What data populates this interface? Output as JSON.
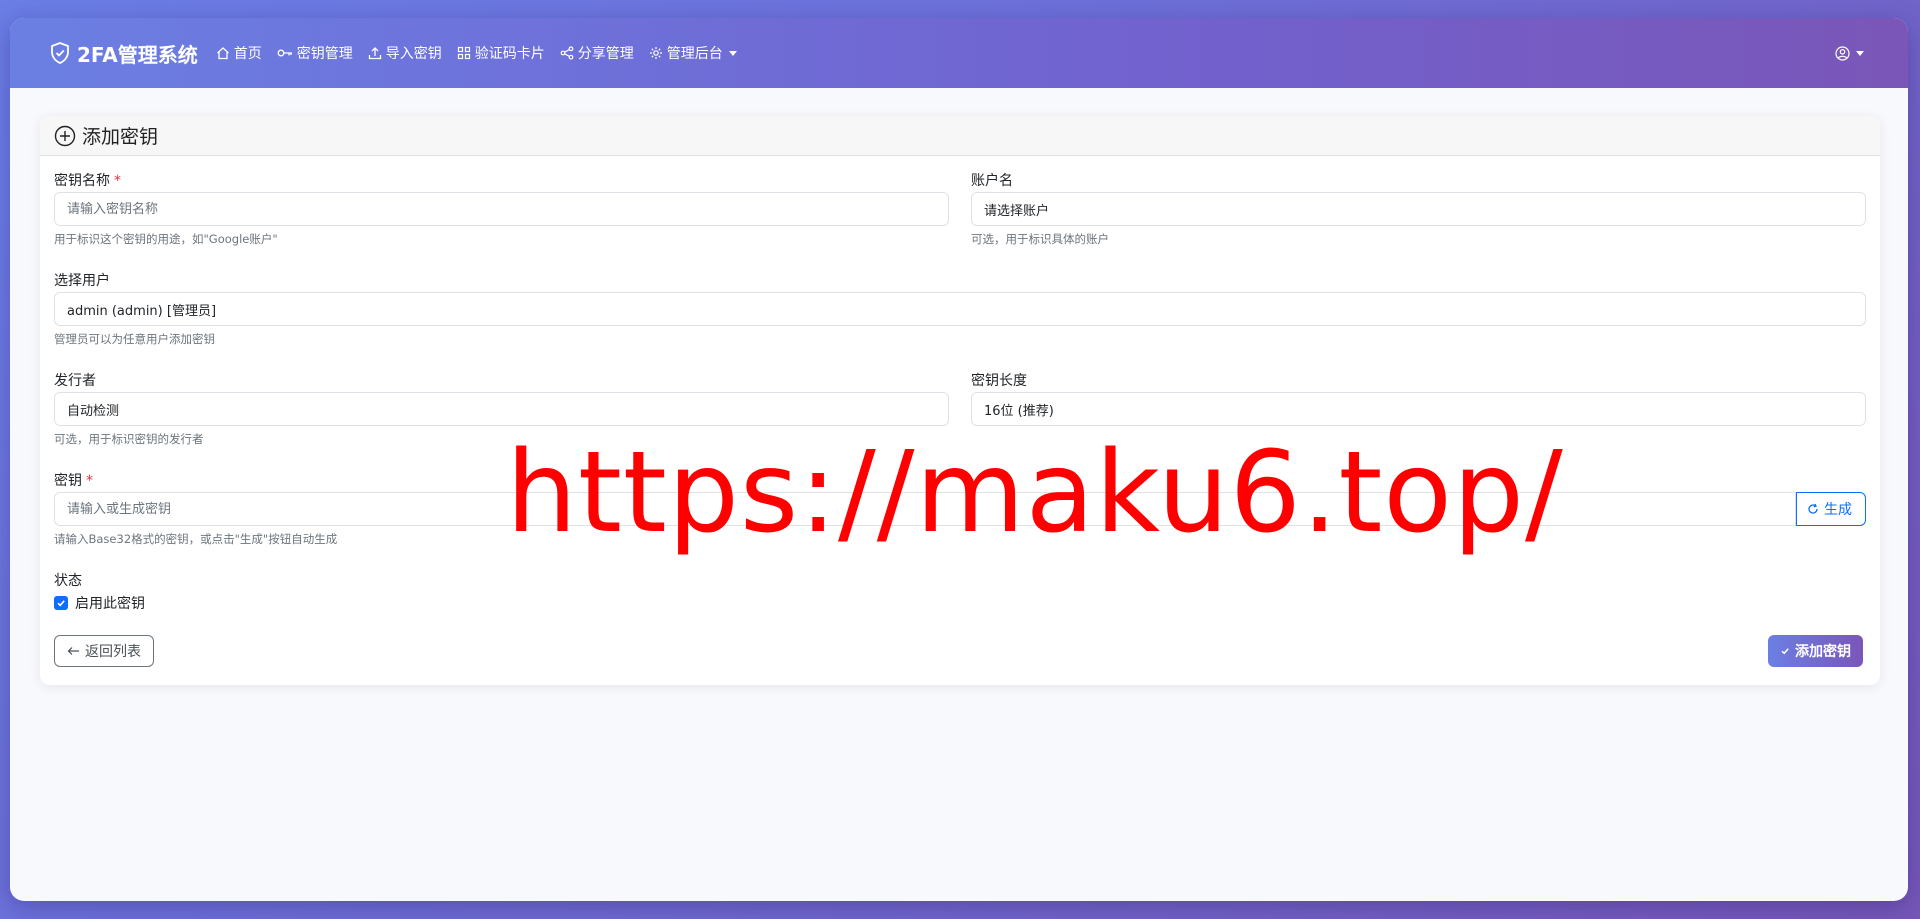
{
  "navbar": {
    "brand": "2FA管理系统",
    "items": [
      {
        "label": "首页",
        "icon": "home-icon"
      },
      {
        "label": "密钥管理",
        "icon": "key-icon"
      },
      {
        "label": "导入密钥",
        "icon": "upload-icon"
      },
      {
        "label": "验证码卡片",
        "icon": "grid-icon"
      },
      {
        "label": "分享管理",
        "icon": "share-icon"
      },
      {
        "label": "管理后台",
        "icon": "gear-icon"
      }
    ]
  },
  "card": {
    "title": "添加密钥"
  },
  "form": {
    "name": {
      "label": "密钥名称",
      "required": "*",
      "placeholder": "请输入密钥名称",
      "help": "用于标识这个密钥的用途，如\"Google账户\""
    },
    "account": {
      "label": "账户名",
      "value": "请选择账户",
      "help": "可选，用于标识具体的账户"
    },
    "user": {
      "label": "选择用户",
      "value": "admin (admin) [管理员]",
      "help": "管理员可以为任意用户添加密钥"
    },
    "issuer": {
      "label": "发行者",
      "value": "自动检测",
      "help": "可选，用于标识密钥的发行者"
    },
    "length": {
      "label": "密钥长度",
      "value": "16位 (推荐)"
    },
    "secret": {
      "label": "密钥",
      "required": "*",
      "placeholder": "请输入或生成密钥",
      "help": "请输入Base32格式的密钥，或点击\"生成\"按钮自动生成",
      "generate_label": "生成"
    },
    "status": {
      "label": "状态",
      "checkbox_label": "启用此密钥"
    }
  },
  "actions": {
    "back_label": "返回列表",
    "submit_label": "添加密钥"
  },
  "watermark": "https://maku6.top/",
  "colors": {
    "primary": "#0d6efd",
    "accent_start": "#6b7fe3",
    "accent_end": "#7a56b8",
    "watermark": "#ff0000"
  }
}
